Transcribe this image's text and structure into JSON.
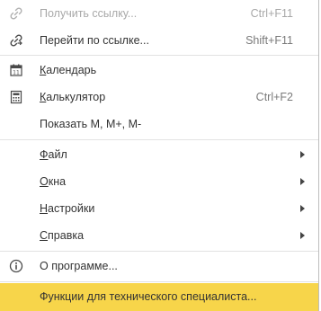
{
  "menu": {
    "items": [
      {
        "label": "Получить ссылку...",
        "shortcut": "Ctrl+F11",
        "icon": "link-icon",
        "disabled": true
      },
      {
        "label": "Перейти по ссылке...",
        "shortcut": "Shift+F11",
        "icon": "go-link-icon",
        "disabled": false
      },
      {
        "label_before": "",
        "label_acc": "К",
        "label_after": "алендарь",
        "icon": "calendar-icon"
      },
      {
        "label_before": "",
        "label_acc": "К",
        "label_after": "алькулятор",
        "shortcut": "Ctrl+F2",
        "icon": "calculator-icon"
      },
      {
        "label": "Показать М, М+, М-"
      },
      {
        "label_before": "",
        "label_acc": "Ф",
        "label_after": "айл",
        "has_submenu": true
      },
      {
        "label_before": "",
        "label_acc": "О",
        "label_after": "кна",
        "has_submenu": true
      },
      {
        "label_before": "",
        "label_acc": "Н",
        "label_after": "астройки",
        "has_submenu": true
      },
      {
        "label_before": "",
        "label_acc": "С",
        "label_after": "правка",
        "has_submenu": true
      },
      {
        "label": "О программе...",
        "icon": "info-icon"
      },
      {
        "label": "Функции для технического специалиста..."
      }
    ]
  },
  "colors": {
    "highlight": "#f7d54a",
    "disabled_text": "#a8a8a8",
    "text": "#333333"
  }
}
